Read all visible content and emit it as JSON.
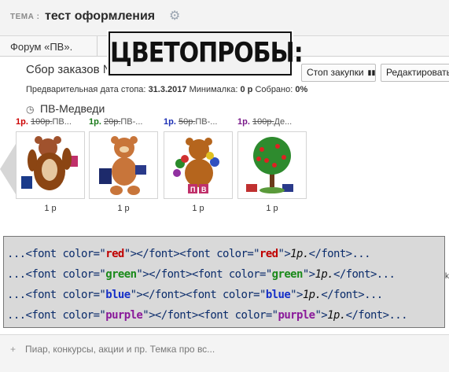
{
  "header": {
    "topic_label": "ТЕМА :",
    "topic_title": "тест оформления",
    "gear_icon": "gear-icon"
  },
  "nav": {
    "forum_label": "Форум «ПВ»."
  },
  "banner": {
    "text": "ЦВЕТОПРОБЫ:"
  },
  "order": {
    "title": "Сбор заказов № 00000",
    "stop_button": "Стоп закупки",
    "edit_button": "Редактировать",
    "info_prefix": "Предварительная дата стопа:",
    "stop_date": "31.3.2017",
    "min_label": "Минималка:",
    "min_value": "0 р",
    "collected_label": "Собрано:",
    "collected_value": "0%"
  },
  "group": {
    "title": "ПВ-Медведи"
  },
  "items": [
    {
      "price_colored": "1р.",
      "price_old": "100р.",
      "name": "ПВ...",
      "price": "1 р",
      "color": "#cc0000"
    },
    {
      "price_colored": "1р.",
      "price_old": "20р.",
      "name": "ПВ-...",
      "price": "1 р",
      "color": "#1a7a1a"
    },
    {
      "price_colored": "1р.",
      "price_old": "50р.",
      "name": "ПВ-...",
      "price": "1 р",
      "color": "#1c2fb5"
    },
    {
      "price_colored": "1р.",
      "price_old": "100р.",
      "name": "Де...",
      "price": "1 р",
      "color": "#7a1a8a"
    }
  ],
  "code": [
    {
      "pre": "...<font color=\"",
      "val": "red",
      "mid": "\"></font><font color=\"",
      "val2": "red",
      "post": "\">",
      "it": "1р.",
      "end": "</font>...",
      "color": "#c00000"
    },
    {
      "pre": "...<font color=\"",
      "val": "green",
      "mid": "\"></font><font color=\"",
      "val2": "green",
      "post": "\">",
      "it": "1р.",
      "end": "</font>...",
      "color": "#1a8a1a"
    },
    {
      "pre": "...<font color=\"",
      "val": "blue",
      "mid": "\"></font><font color=\"",
      "val2": "blue",
      "post": "\">",
      "it": "1р.",
      "end": "</font>...",
      "color": "#1630c8"
    },
    {
      "pre": "...<font color=\"",
      "val": "purple",
      "mid": "\"></font><font color=\"",
      "val2": "purple",
      "post": "\">",
      "it": "1р.",
      "end": "</font>...",
      "color": "#8a1a9a"
    }
  ],
  "side_letter": "k",
  "footer": {
    "text": "Пиар, конкурсы, акции и пр. Темка про вс..."
  }
}
